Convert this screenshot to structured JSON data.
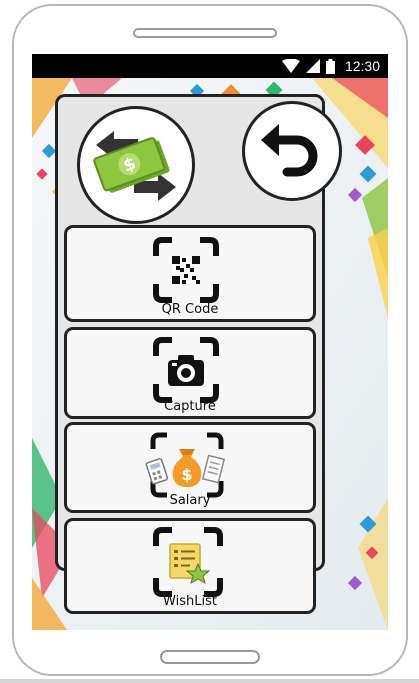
{
  "statusbar": {
    "time": "12:30",
    "icons": [
      "wifi-icon",
      "signal-icon",
      "battery-icon"
    ]
  },
  "header": {
    "logo_icon": "money-transfer-icon",
    "back_icon": "undo-arrow-icon"
  },
  "menu": {
    "items": [
      {
        "label": "QR Code",
        "icon": "qr-scan-icon"
      },
      {
        "label": "Capture",
        "icon": "camera-icon"
      },
      {
        "label": "Salary",
        "icon": "money-bag-icon"
      },
      {
        "label": "WishList",
        "icon": "wishlist-icon"
      }
    ]
  },
  "colors": {
    "accent_green": "#8dc63f",
    "panel_border": "#222222",
    "statusbar": "#000000",
    "money_orange": "#f39c2b"
  }
}
